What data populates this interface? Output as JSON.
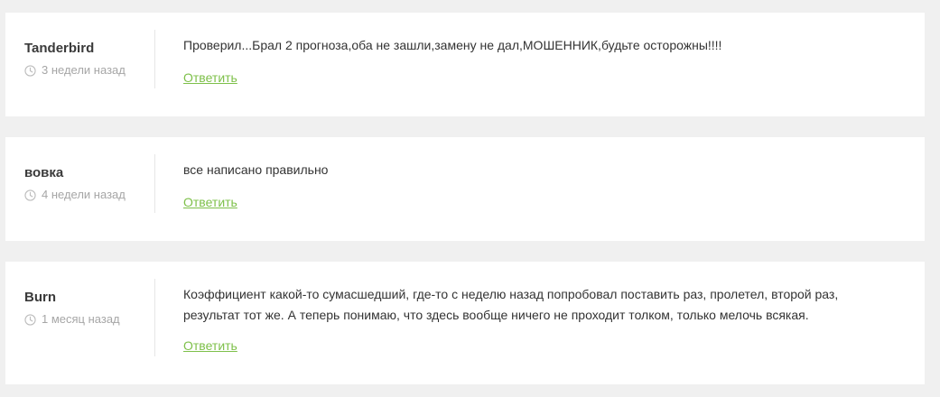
{
  "colors": {
    "background": "#f0f0f0",
    "card": "#ffffff",
    "reply_link": "#7ec04a",
    "muted": "#a6a6a6"
  },
  "comments": [
    {
      "author": "Tanderbird",
      "time": "3 недели назад",
      "text": "Проверил...Брал 2 прогноза,оба не зашли,замену не дал,МОШЕННИК,будьте осторожны!!!!",
      "reply_label": "Ответить",
      "clock_icon": "clock-icon"
    },
    {
      "author": "вовка",
      "time": "4 недели назад",
      "text": "все написано правильно",
      "reply_label": "Ответить",
      "clock_icon": "clock-icon"
    },
    {
      "author": "Burn",
      "time": "1 месяц назад",
      "text": "Коэффициент какой-то сумасшедший, где-то с неделю назад попробовал поставить раз, пролетел, второй раз, результат тот же. А теперь понимаю, что здесь вообще ничего не проходит толком, только мелочь всякая.",
      "reply_label": "Ответить",
      "clock_icon": "clock-icon"
    }
  ]
}
